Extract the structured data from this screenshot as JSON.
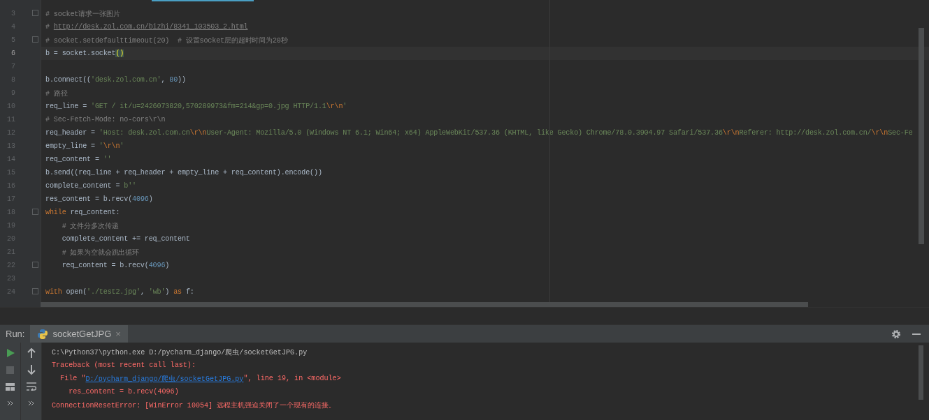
{
  "editor": {
    "lines": [
      {
        "number": "3",
        "fold": true,
        "segments": [
          {
            "kind": "comment",
            "text": "# socket请求一张图片"
          }
        ]
      },
      {
        "number": "4",
        "segments": [
          {
            "kind": "comment",
            "text": "# "
          },
          {
            "kind": "link",
            "text": "http://desk.zol.com.cn/bizhi/8341_103503_2.html"
          }
        ]
      },
      {
        "number": "5",
        "fold": true,
        "segments": [
          {
            "kind": "comment",
            "text": "# socket.setdefaulttimeout(20)  # 设置socket层的超时时间为20秒"
          }
        ]
      },
      {
        "number": "6",
        "current": true,
        "segments": [
          {
            "kind": "plain",
            "text": "b = socket.socket"
          },
          {
            "kind": "match",
            "text": "()"
          }
        ]
      },
      {
        "number": "7"
      },
      {
        "number": "8",
        "segments": [
          {
            "kind": "plain",
            "text": "b.connect(("
          },
          {
            "kind": "string",
            "text": "'desk.zol.com.cn'"
          },
          {
            "kind": "plain",
            "text": ", "
          },
          {
            "kind": "number",
            "text": "80"
          },
          {
            "kind": "plain",
            "text": "))"
          }
        ]
      },
      {
        "number": "9",
        "segments": [
          {
            "kind": "comment",
            "text": "# 路径"
          }
        ]
      },
      {
        "number": "10",
        "segments": [
          {
            "kind": "plain",
            "text": "req_line = "
          },
          {
            "kind": "string",
            "text": "'GET / it/u=2426073820,570289973&fm=214&gp=0.jpg HTTP/1.1"
          },
          {
            "kind": "escape",
            "text": "\\r\\n"
          },
          {
            "kind": "string",
            "text": "'"
          }
        ]
      },
      {
        "number": "11",
        "segments": [
          {
            "kind": "comment",
            "text": "# Sec-Fetch-Mode: no-cors\\r\\n"
          }
        ]
      },
      {
        "number": "12",
        "segments": [
          {
            "kind": "plain",
            "text": "req_header = "
          },
          {
            "kind": "string",
            "text": "'Host: desk.zol.com.cn"
          },
          {
            "kind": "escape",
            "text": "\\r\\n"
          },
          {
            "kind": "string",
            "text": "User-Agent: Mozilla/5.0 (Windows NT 6.1; Win64; x64) AppleWebKit/537.36 (KHTML, like Gecko) Chrome/78.0.3904.97 Safari/537.36"
          },
          {
            "kind": "escape",
            "text": "\\r\\n"
          },
          {
            "kind": "string",
            "text": "Referer: http://desk.zol.com.cn/"
          },
          {
            "kind": "escape",
            "text": "\\r\\n"
          },
          {
            "kind": "string",
            "text": "Sec-Fe"
          }
        ]
      },
      {
        "number": "13",
        "segments": [
          {
            "kind": "plain",
            "text": "empty_line = "
          },
          {
            "kind": "string",
            "text": "'"
          },
          {
            "kind": "escape",
            "text": "\\r\\n"
          },
          {
            "kind": "string",
            "text": "'"
          }
        ]
      },
      {
        "number": "14",
        "segments": [
          {
            "kind": "plain",
            "text": "req_content = "
          },
          {
            "kind": "string",
            "text": "''"
          }
        ]
      },
      {
        "number": "15",
        "segments": [
          {
            "kind": "plain",
            "text": "b.send((req_line + req_header + empty_line + req_content).encode())"
          }
        ]
      },
      {
        "number": "16",
        "segments": [
          {
            "kind": "plain",
            "text": "complete_content = "
          },
          {
            "kind": "string",
            "text": "b''"
          }
        ]
      },
      {
        "number": "17",
        "segments": [
          {
            "kind": "plain",
            "text": "res_content = b.recv("
          },
          {
            "kind": "number",
            "text": "4096"
          },
          {
            "kind": "plain",
            "text": ")"
          }
        ]
      },
      {
        "number": "18",
        "fold": true,
        "segments": [
          {
            "kind": "keyword",
            "text": "while"
          },
          {
            "kind": "plain",
            "text": " req_content:"
          }
        ]
      },
      {
        "number": "19",
        "segments": [
          {
            "kind": "comment",
            "text": "    # 文件分多次传递"
          }
        ]
      },
      {
        "number": "20",
        "segments": [
          {
            "kind": "plain",
            "text": "    complete_content += req_content"
          }
        ]
      },
      {
        "number": "21",
        "segments": [
          {
            "kind": "comment",
            "text": "    # 如果为空就会跳出循环"
          }
        ]
      },
      {
        "number": "22",
        "fold": true,
        "segments": [
          {
            "kind": "plain",
            "text": "    req_content = b.recv("
          },
          {
            "kind": "number",
            "text": "4096"
          },
          {
            "kind": "plain",
            "text": ")"
          }
        ]
      },
      {
        "number": "23"
      },
      {
        "number": "24",
        "fold": true,
        "segments": [
          {
            "kind": "keyword",
            "text": "with"
          },
          {
            "kind": "plain",
            "text": " open("
          },
          {
            "kind": "string",
            "text": "'./test2.jpg'"
          },
          {
            "kind": "plain",
            "text": ", "
          },
          {
            "kind": "string",
            "text": "'wb'"
          },
          {
            "kind": "plain",
            "text": ") "
          },
          {
            "kind": "keyword",
            "text": "as"
          },
          {
            "kind": "plain",
            "text": " f:"
          }
        ]
      }
    ]
  },
  "run_panel": {
    "label": "Run:",
    "tab": {
      "title": "socketGetJPG",
      "close": "×",
      "selected": true
    },
    "console": [
      {
        "kind": "command",
        "segments": [
          {
            "kind": "plain",
            "text": "C:\\Python37\\python.exe D:/pycharm_django/爬虫/socketGetJPG.py"
          }
        ]
      },
      {
        "kind": "error",
        "segments": [
          {
            "kind": "plain",
            "text": "Traceback (most recent call last):"
          }
        ]
      },
      {
        "kind": "error",
        "segments": [
          {
            "kind": "plain",
            "text": "  File \""
          },
          {
            "kind": "link",
            "text": "D:/pycharm_django/爬虫/socketGetJPG.py"
          },
          {
            "kind": "plain",
            "text": "\", line 19, in <module>"
          }
        ]
      },
      {
        "kind": "error",
        "segments": [
          {
            "kind": "plain",
            "text": "    res_content = b.recv(4096)"
          }
        ]
      },
      {
        "kind": "error",
        "segments": [
          {
            "kind": "plain",
            "text": "ConnectionResetError: [WinError 10054] 远程主机强迫关闭了一个现有的连接。"
          }
        ]
      }
    ]
  }
}
